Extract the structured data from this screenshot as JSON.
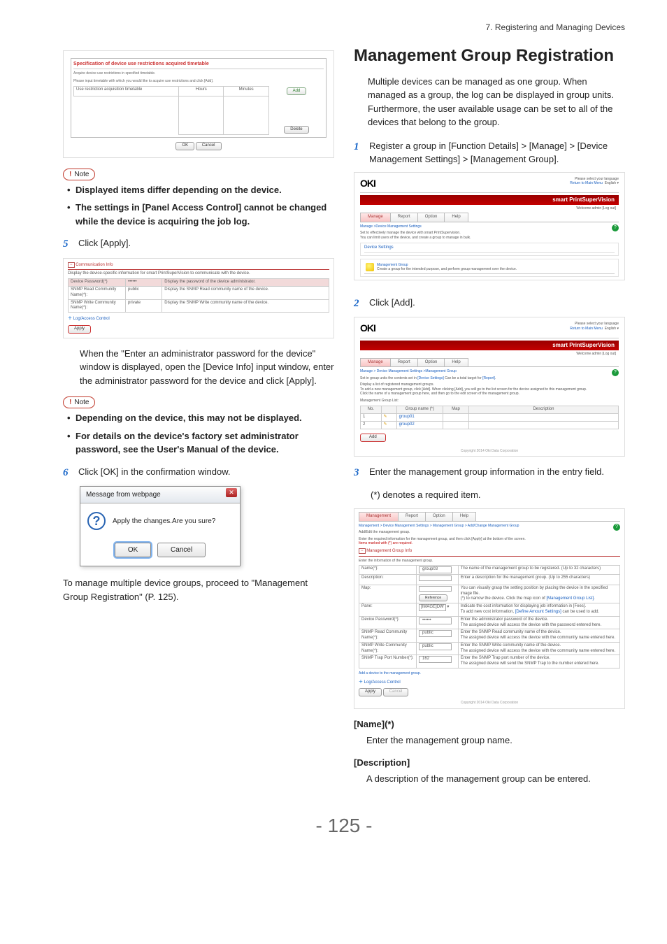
{
  "header_path": "7. Registering and Managing Devices",
  "left": {
    "shot1": {
      "panel_title": "Specification of device use restrictions acquired timetable",
      "panel_sub1": "Acquire device use restrictions in specified timetable.",
      "panel_sub2": "Please input timetable with which you would like to acquire use restrictions and click [Add].",
      "row_label": "Use restriction acquisition timetable",
      "col_hours": "Hours",
      "col_minutes": "Minutes",
      "btn_add": "Add",
      "btn_delete": "Delete",
      "btn_ok": "OK",
      "btn_cancel": "Cancel"
    },
    "note1": {
      "label": "Note",
      "li1": "Displayed items differ depending on the device.",
      "li2": "The settings in [Panel Access Control] cannot be changed while the device is acquiring the job log."
    },
    "step5": "Click [Apply].",
    "shot2": {
      "section": "Communication Info",
      "row0_l": "Display the device-specific information for smart PrintSuperVision to communicate with the device.",
      "row1_l": "Device Password(*)",
      "row1_v": "••••••",
      "row1_r": "Display the password of the device administrator.",
      "row2_l": "SNMP Read Community Name(*):",
      "row2_v": "public",
      "row2_r": "Display the SNMP Read community name of the device.",
      "row3_l": "SNMP Write Community Name(*):",
      "row3_v": "private",
      "row3_r": "Display the SNMP Write community name of the device.",
      "lac": "Log/Access Control",
      "apply": "Apply"
    },
    "after2": "When the \"Enter an administrator password for the device\" window is displayed, open the [Device Info] input window, enter the administrator password for the device and click [Apply].",
    "note2": {
      "label": "Note",
      "li1": "Depending on the device, this may not be displayed.",
      "li2": "For details on the device's factory set administrator password, see the User's Manual of the device."
    },
    "step6": "Click [OK] in the confirmation window.",
    "dlg": {
      "title": "Message from webpage",
      "body": "Apply the changes.Are you sure?",
      "ok": "OK",
      "cancel": "Cancel"
    },
    "bottom_para": "To manage multiple device groups, proceed to \"Management Group Registration\" (P. 125)."
  },
  "right": {
    "h1": "Management Group Registration",
    "intro": "Multiple devices can be managed as one group. When managed as a group, the log can be displayed in group units. Furthermore, the user available usage can be set to all of the devices that belong to the group.",
    "step1": "Register a group in [Function Details] > [Manage] > [Device Management Settings] > [Management Group].",
    "oki_logo": "OKI",
    "top_right": {
      "lang_label": "Please select your language",
      "return": "Return to Main Menu",
      "lang": "English",
      "spv": "smart PrintSuperVision",
      "welcome": "Welcome admin [Log out]"
    },
    "tabs": {
      "manage": "Manage",
      "report": "Report",
      "option": "Option",
      "help": "Help"
    },
    "shotA": {
      "breadcrumb": "Manage >Device Management Settings",
      "l1": "Set to effectively manage the device with smart PrintSupervision.",
      "l2": "You can limit users of the device, and create a group to manage in bulk.",
      "ds": "Device Settings",
      "mg_title": "Management Group",
      "mg_desc": "Create a group for the intended purpose, and perform group management over the device."
    },
    "step2": "Click [Add].",
    "shotB": {
      "breadcrumb": "Manage > Device Management Settings >Management Group",
      "l1a": "Set in group units the contents set in",
      "l1b": "[Device Settings]",
      "l1c": " Can be a total target for",
      "l1d": "[Report]",
      "l2": "Display a list of registered management groups.",
      "l3": "To add a new management group, click [Add]. When clicking [Add], you will go to the list screen for the device assigned to this management group.",
      "l4": "Click the name of a management group here, and then go to the edit screen of the management group.",
      "list_label": "Management Group List:",
      "th_no": "No.",
      "th_gn": "Group name (*)",
      "th_map": "Map",
      "th_desc": "Description",
      "r1_no": "1",
      "r1_name": "group01",
      "r2_no": "2",
      "r2_name": "group02",
      "add": "Add"
    },
    "step3": "Enter the management group information in the entry field.",
    "star_note": "(*) denotes a required item.",
    "shotC": {
      "tabs": {
        "manage": "Management",
        "report": "Report",
        "option": "Option",
        "help": "Help"
      },
      "bc": "Management > Device Management Settings > Management Group > Add/Change Management Group",
      "l1": "Add/Edit the management group.",
      "l2": "Enter the required information for the management group, and then click [Apply] at the bottom of the screen.",
      "l3": "Items marked with (*) are required.",
      "section": "Management Group Info",
      "leadin": "Enter the information of the management group.",
      "rows": {
        "name_l": "Name(*):",
        "name_v": "group03",
        "name_r": "The name of the management group to be registered. (Up to 32 characters)",
        "desc_l": "Description:",
        "desc_r": "Enter a description for the management group. (Up to 255 characters)",
        "map_l": "Map:",
        "map_ra": "You can visually grasp the setting position by placing the device in the specified image file.",
        "map_rb": "(*) to narrow the device. Click the map icon of",
        "map_rc": "[Management Group List]",
        "ref": "Reference",
        "pane_l": "Pane:",
        "pane_v": "[IMAGE]DW",
        "pane_ra": "Indicate the cost information for displaying job information in [Fees].",
        "pane_rb": "To add new cost information,",
        "pane_rc": "[Define Amount Settings]",
        "pane_rd": " can be used to add.",
        "dp_l": "Device Password(*):",
        "dp_v": "••••••",
        "dp_ra": "Enter the administrator password of the device.",
        "dp_rb": "The assigned device will access the device with the password entered here.",
        "sr_l": "SNMP Read Community Name(*):",
        "sr_v": "public",
        "sr_ra": "Enter the SNMP Read community name of the device.",
        "sr_rb": "The assigned device will access the device with the community name entered here.",
        "sw_l": "SNMP Write Community Name(*):",
        "sw_v": "public",
        "sw_ra": "Enter the SNMP Write community name of the device.",
        "sw_rb": "The assigned device will access the device with the community name entered here.",
        "tp_l": "SNMP Trap Port Number(*):",
        "tp_v": "162",
        "tp_ra": "Enter the SNMP Trap port number of the device.",
        "tp_rb": "The assigned device will send the SNMP Trap to the number entered here."
      },
      "add_dev": "Add a device to the management group.",
      "lac": "Log/Access Control",
      "apply": "Apply",
      "cancel": "Cancel"
    },
    "copyright": "Copyright 2014 Oki Data Corporation",
    "sections": {
      "name_h": "[Name](*)",
      "name_b": "Enter the management group name.",
      "desc_h": "[Description]",
      "desc_b": "A description of the management group can be entered."
    }
  },
  "page_number": "- 125 -"
}
